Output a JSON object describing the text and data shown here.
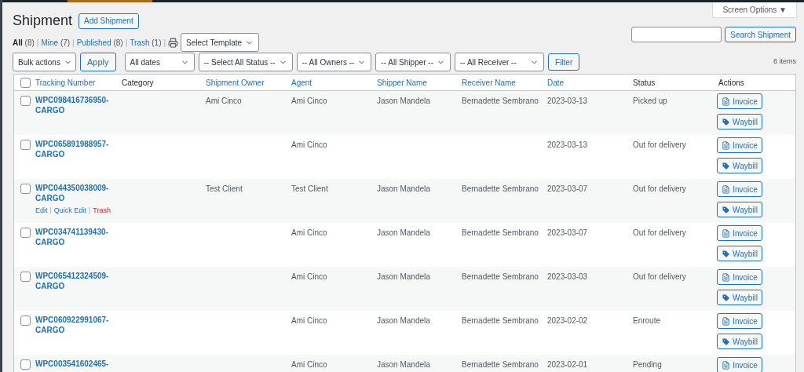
{
  "screen_options": {
    "label": "Screen Options ▼"
  },
  "page_title": "Shipment",
  "add_button": "Add Shipment",
  "views": [
    {
      "label": "All",
      "count": "(8)",
      "selected": true,
      "separator": "|"
    },
    {
      "label": "Mine",
      "count": "(7)",
      "selected": false,
      "separator": "|"
    },
    {
      "label": "Published",
      "count": "(8)",
      "selected": false,
      "separator": "|"
    },
    {
      "label": "Trash",
      "count": "(1)",
      "selected": false,
      "separator": "|"
    }
  ],
  "template_select": "Select Template",
  "search": {
    "button": "Search Shipment"
  },
  "bulk_select": "Bulk actions",
  "apply_button": "Apply",
  "filters": [
    "All dates",
    "-- Select All Status --",
    "-- All Owners --",
    "-- All Shipper --",
    "-- All Receiver --"
  ],
  "filter_button": "Filter",
  "item_count": "8 items",
  "table": {
    "select_all_checked": false,
    "columns": [
      {
        "label": "Tracking Number",
        "kind": "link"
      },
      {
        "label": "Category",
        "kind": "text"
      },
      {
        "label": "Shipment Owner",
        "kind": "link"
      },
      {
        "label": "Agent",
        "kind": "link"
      },
      {
        "label": "Shipper Name",
        "kind": "link"
      },
      {
        "label": "Receiver Name",
        "kind": "link"
      },
      {
        "label": "Date",
        "kind": "link"
      },
      {
        "label": "Status",
        "kind": "text"
      },
      {
        "label": "Actions",
        "kind": "text"
      }
    ],
    "rows": [
      {
        "tracking": "WPC098416736950-CARGO",
        "owner": "Ami Cinco",
        "agent": "Ami Cinco",
        "shipper": "Jason Mandela",
        "receiver": "Bernadette Sembrano",
        "date": "2023-03-13",
        "status": "Picked up",
        "checked": false,
        "actions": [
          {
            "kind": "invoice",
            "label": "Invoice"
          },
          {
            "kind": "waybill",
            "label": "Waybill"
          }
        ]
      },
      {
        "tracking": "WPC065891988957-CARGO",
        "agent": "Ami Cinco",
        "date": "2023-03-13",
        "status": "Out for delivery",
        "checked": false,
        "actions": [
          {
            "kind": "invoice",
            "label": "Invoice"
          },
          {
            "kind": "waybill",
            "label": "Waybill"
          }
        ]
      },
      {
        "tracking": "WPC044350038009-CARGO",
        "owner": "Test Client",
        "agent": "Test Client",
        "shipper": "Jason Mandela",
        "receiver": "Bernadette Sembrano",
        "date": "2023-03-07",
        "status": "Out for delivery",
        "checked": false,
        "row_actions": [
          {
            "kind": "edit",
            "label": "Edit"
          },
          {
            "kind": "edit",
            "label": "Quick Edit",
            "separator": "|"
          },
          {
            "kind": "trash",
            "label": "Trash",
            "separator": "|"
          }
        ],
        "actions": [
          {
            "kind": "invoice",
            "label": "Invoice"
          },
          {
            "kind": "waybill",
            "label": "Waybill"
          }
        ]
      },
      {
        "tracking": "WPC034741139430-CARGO",
        "agent": "Ami Cinco",
        "shipper": "Jason Mandela",
        "receiver": "Bernadette Sembrano",
        "date": "2023-03-07",
        "status": "Out for delivery",
        "checked": false,
        "actions": [
          {
            "kind": "invoice",
            "label": "Invoice"
          },
          {
            "kind": "waybill",
            "label": "Waybill"
          }
        ]
      },
      {
        "tracking": "WPC065412324509-CARGO",
        "agent": "Ami Cinco",
        "shipper": "Jason Mandela",
        "receiver": "Bernadette Sembrano",
        "date": "2023-03-03",
        "status": "Out for delivery",
        "checked": false,
        "actions": [
          {
            "kind": "invoice",
            "label": "Invoice"
          },
          {
            "kind": "waybill",
            "label": "Waybill"
          }
        ]
      },
      {
        "tracking": "WPC060922991067-CARGO",
        "agent": "Ami Cinco",
        "shipper": "Jason Mandela",
        "receiver": "Bernadette Sembrano",
        "date": "2023-02-02",
        "status": "Enroute",
        "checked": false,
        "actions": [
          {
            "kind": "invoice",
            "label": "Invoice"
          },
          {
            "kind": "waybill",
            "label": "Waybill"
          }
        ]
      },
      {
        "tracking": "WPC003541602465-",
        "agent": "Ami Cinco",
        "shipper": "Jason Mandela",
        "receiver": "Bernadette Sembrano",
        "date": "2023-02-01",
        "status": "Pending",
        "checked": false,
        "actions": [
          {
            "kind": "invoice",
            "label": "Invoice"
          }
        ]
      }
    ]
  }
}
